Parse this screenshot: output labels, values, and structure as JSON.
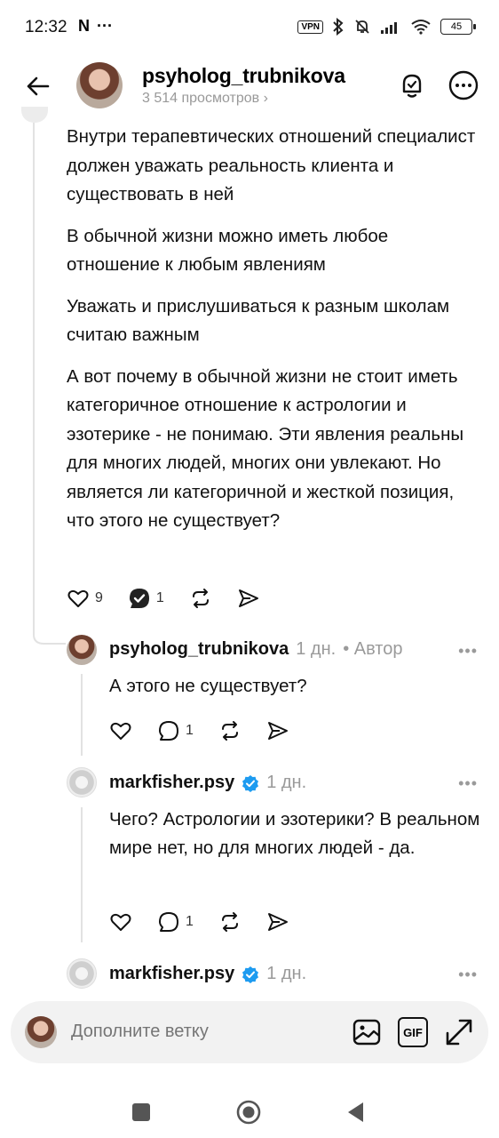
{
  "status_bar": {
    "time": "12:32",
    "left_icons": [
      "N",
      "···"
    ],
    "vpn": "VPN",
    "battery": "45"
  },
  "header": {
    "username": "psyholog_trubnikova",
    "views": "3 514 просмотров",
    "views_chevron": "›"
  },
  "post": {
    "paragraphs": [
      "Внутри терапевтических отношений специалист должен уважать реальность клиента и существовать в ней",
      "В обычной жизни можно иметь любое отношение к любым явлениям",
      "Уважать и прислушиваться к разным школам считаю важным",
      "А вот почему в обычной жизни не стоит иметь категоричное отношение к астрологии и эзотерике - не понимаю. Эти явления реальны для многих людей, многих они увлекают. Но является ли категоричной и жесткой позиция, что этого не существует?"
    ],
    "likes": "9",
    "replies": "1"
  },
  "replies": [
    {
      "username": "psyholog_trubnikova",
      "time": "1 дн.",
      "tag": "• Автор",
      "text": "А этого не существует?",
      "replies": "1",
      "verified": false
    },
    {
      "username": "markfisher.psy",
      "time": "1 дн.",
      "tag": "",
      "text": "Чего? Астрологии и эзотерики? В реальном мире нет, но для многих людей - да.",
      "replies": "1",
      "verified": true
    },
    {
      "username": "markfisher.psy",
      "time": "1 дн.",
      "tag": "",
      "verified": true
    }
  ],
  "more_label": "•••",
  "composer": {
    "placeholder": "Дополните ветку",
    "gif_label": "GIF"
  },
  "colors": {
    "verified_blue": "#1d9bf0",
    "muted_text": "#9a9a9a",
    "thread_line": "#e2e2e2"
  }
}
